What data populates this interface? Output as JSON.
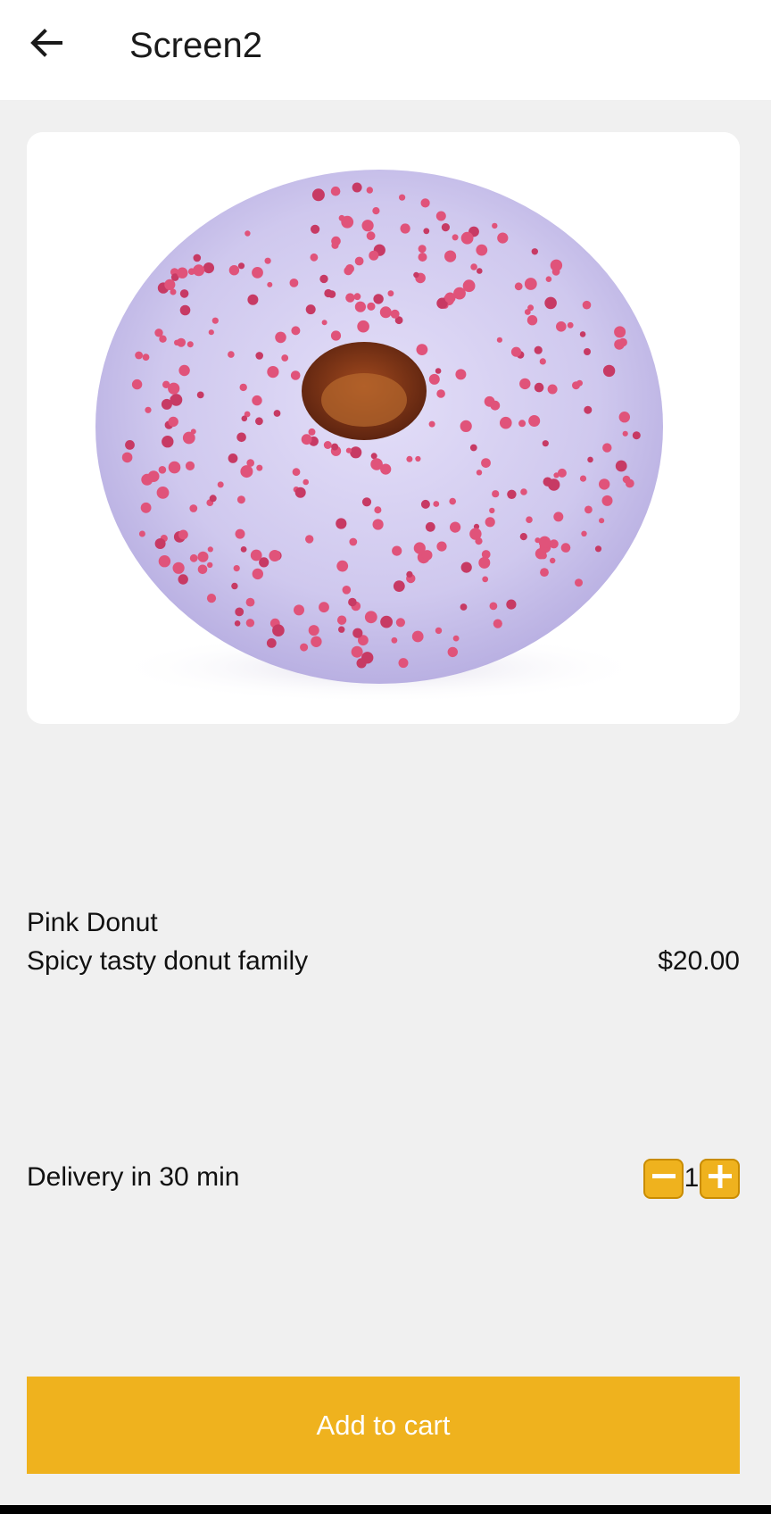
{
  "appbar": {
    "title": "Screen2",
    "back_icon": "arrow-left-icon"
  },
  "product": {
    "image_icon": "donut-image",
    "name": "Pink Donut",
    "description": "Spicy tasty donut family",
    "price": "$20.00"
  },
  "delivery": {
    "text": "Delivery in 30 min"
  },
  "quantity": {
    "decrement_icon": "minus-icon",
    "value": "1",
    "increment_icon": "plus-icon"
  },
  "cart": {
    "button_label": "Add to cart"
  },
  "colors": {
    "accent": "#EFB21E",
    "accent_border": "#C98C00",
    "background": "#F0F0F0",
    "surface": "#FFFFFF",
    "donut_glaze": "#CFC8EE",
    "sprinkles": "#E0537A"
  }
}
